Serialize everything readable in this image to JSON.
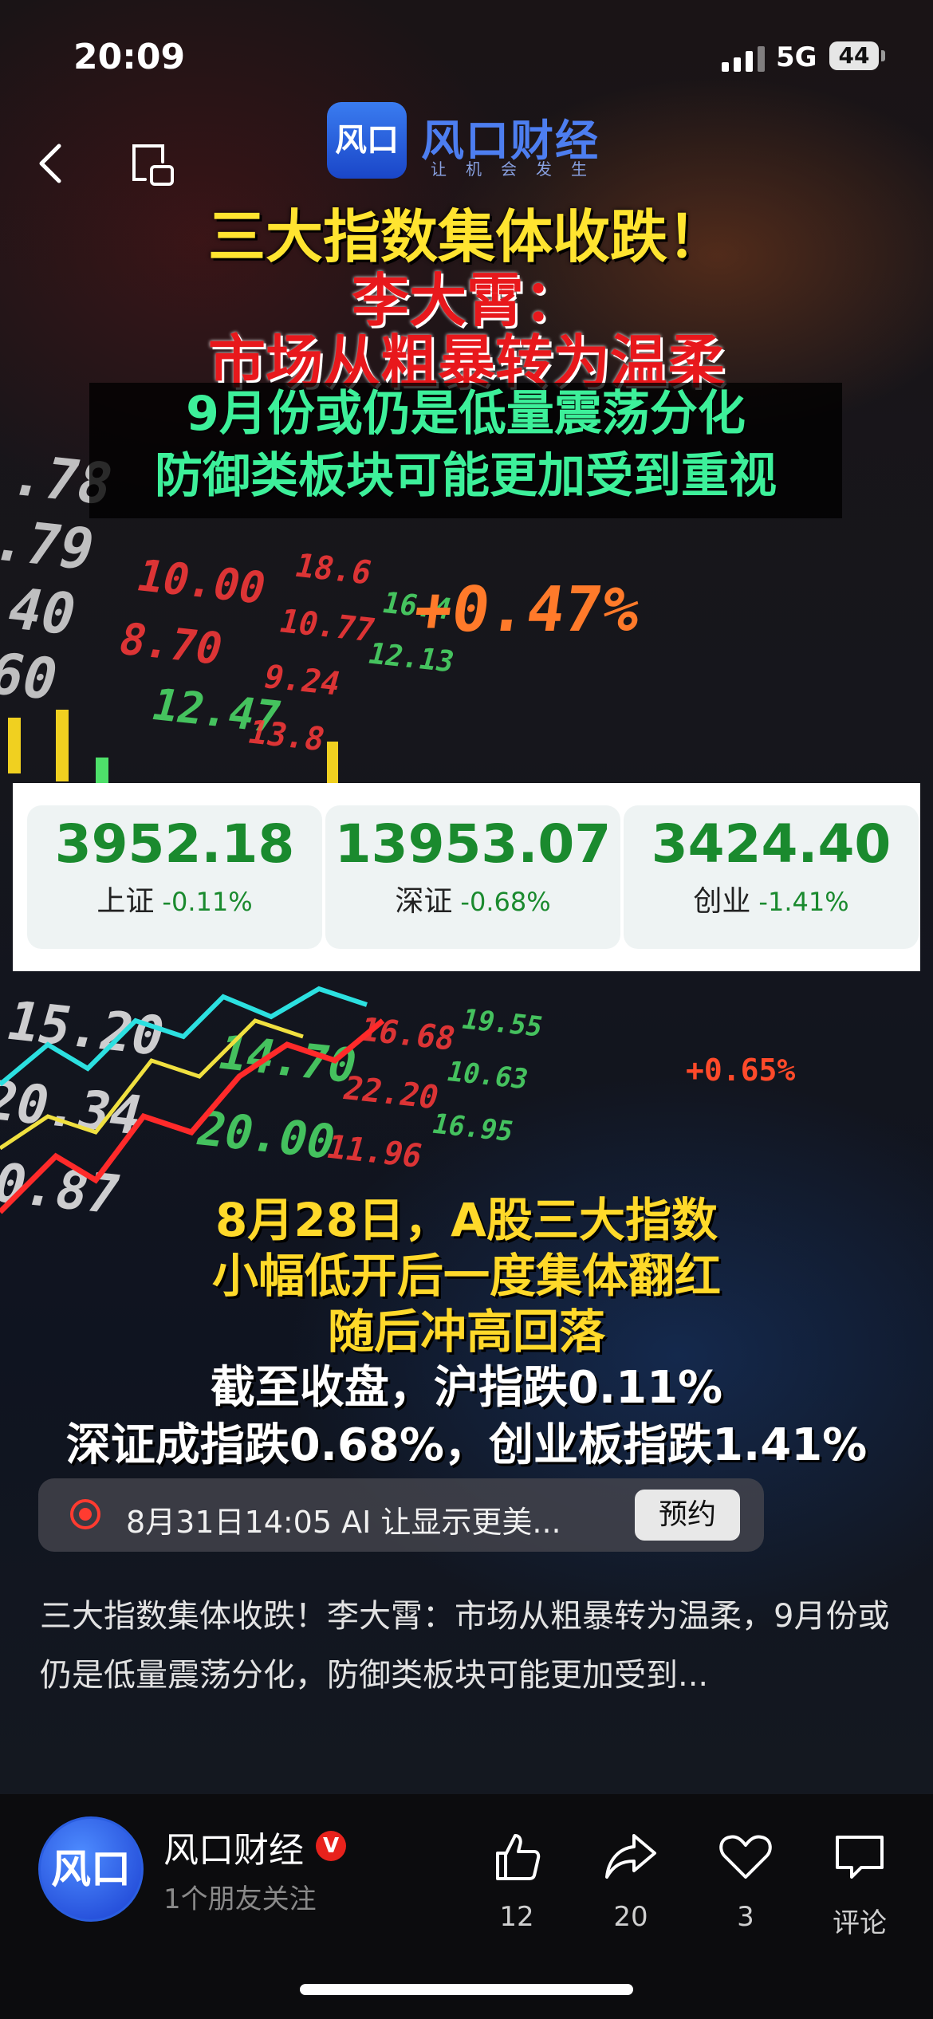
{
  "status": {
    "time": "20:09",
    "network": "5G",
    "battery": "44"
  },
  "brand": {
    "logo_text": "风口",
    "name": "风口财经",
    "slogan": "让机会发生"
  },
  "headline": {
    "line1": "三大指数集体收跌！",
    "line2": "李大霄：",
    "line3": "市场从粗暴转为温柔",
    "sub1": "9月份或仍是低量震荡分化",
    "sub2": "防御类板块可能更加受到重视"
  },
  "indices": [
    {
      "value": "3952.18",
      "name": "上证",
      "change": "-0.11%"
    },
    {
      "value": "13953.07",
      "name": "深证",
      "change": "-0.68%"
    },
    {
      "value": "3424.40",
      "name": "创业",
      "change": "-1.41%"
    }
  ],
  "board_tags": {
    "big": "+0.47%",
    "mid": "+0.65%"
  },
  "body": {
    "line1": "8月28日，A股三大指数",
    "line2": "小幅低开后一度集体翻红",
    "line3": "随后冲高回落",
    "line4": "截至收盘，沪指跌0.11%",
    "line5": "深证成指跌0.68%，创业板指跌1.41%"
  },
  "live": {
    "text": "8月31日14:05 AI 让显示更美...",
    "button": "预约"
  },
  "description": "三大指数集体收跌！李大霄：市场从粗暴转为温柔，9月份或仍是低量震荡分化，防御类板块可能更加受到...",
  "author": {
    "avatar_text": "风口",
    "name": "风口财经",
    "badge": "V",
    "followers": "1个朋友关注"
  },
  "actions": {
    "likes": "12",
    "shares": "20",
    "favorites": "3",
    "comment_label": "评论"
  },
  "colors": {
    "accent_green": "#1a8a2e",
    "headline_yellow": "#ffe430",
    "headline_red": "#e8181c",
    "sub_green": "#3df09a"
  }
}
